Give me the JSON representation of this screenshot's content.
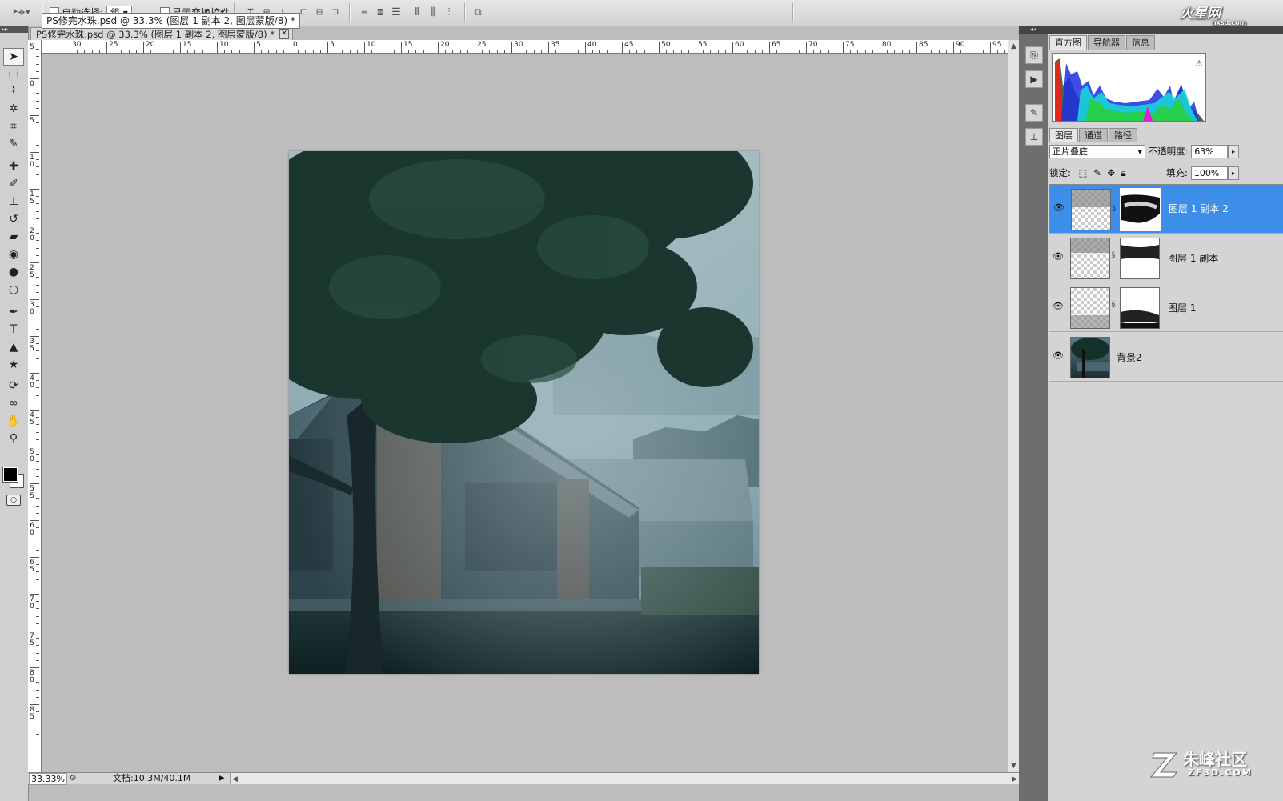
{
  "options_bar": {
    "auto_select_label": "自动选择:",
    "auto_select_value": "组",
    "show_transform_label": "显示变换控件"
  },
  "document": {
    "tooltip": "PS修完水珠.psd @ 33.3% (图层 1 副本 2, 图层蒙版/8) *",
    "tab_title": "PS修完水珠.psd @ 33.3% (图层 1 副本 2, 图层蒙版/8) *",
    "close_glyph": "✕"
  },
  "ruler": {
    "horizontal_labels": [
      "30",
      "25",
      "20",
      "15",
      "10",
      "5",
      "0",
      "5",
      "10",
      "15",
      "20",
      "25",
      "30",
      "35",
      "40",
      "45",
      "50",
      "55",
      "60",
      "65",
      "70",
      "75",
      "80",
      "85",
      "90",
      "95"
    ],
    "vertical_labels": [
      "5",
      "0",
      "5",
      "1\n0",
      "1\n5",
      "2\n0",
      "2\n5",
      "3\n0",
      "3\n5",
      "4\n0",
      "4\n5",
      "5\n0",
      "5\n5",
      "6\n0",
      "6\n5",
      "7\n0",
      "7\n5",
      "8\n0",
      "8\n5"
    ]
  },
  "tools": [
    {
      "name": "move-tool",
      "glyph": "➤"
    },
    {
      "name": "marquee-tool",
      "glyph": "⬚"
    },
    {
      "name": "lasso-tool",
      "glyph": "⌇"
    },
    {
      "name": "quick-select-tool",
      "glyph": "✲"
    },
    {
      "name": "crop-tool",
      "glyph": "⌗"
    },
    {
      "name": "eyedropper-tool",
      "glyph": "✎"
    },
    {
      "name": "healing-brush-tool",
      "glyph": "✚"
    },
    {
      "name": "brush-tool",
      "glyph": "✐"
    },
    {
      "name": "clone-stamp-tool",
      "glyph": "⊥"
    },
    {
      "name": "history-brush-tool",
      "glyph": "↺"
    },
    {
      "name": "eraser-tool",
      "glyph": "▰"
    },
    {
      "name": "paint-bucket-tool",
      "glyph": "◉"
    },
    {
      "name": "blur-tool",
      "glyph": "●"
    },
    {
      "name": "dodge-tool",
      "glyph": "○"
    },
    {
      "name": "pen-tool",
      "glyph": "✒"
    },
    {
      "name": "type-tool",
      "glyph": "T"
    },
    {
      "name": "path-select-tool",
      "glyph": "▲"
    },
    {
      "name": "shape-tool",
      "glyph": "★"
    },
    {
      "name": "3d-rotate-tool",
      "glyph": "⟳"
    },
    {
      "name": "3d-orbit-tool",
      "glyph": "∞"
    },
    {
      "name": "hand-tool",
      "glyph": "✋"
    },
    {
      "name": "zoom-tool",
      "glyph": "⚲"
    }
  ],
  "status": {
    "zoom": "33.33%",
    "doc_info": "文档:10.3M/40.1M"
  },
  "panels": {
    "top_tabs": [
      "直方图",
      "导航器",
      "信息"
    ],
    "histogram_warning": "⚠",
    "layer_tabs": [
      "图层",
      "通道",
      "路径"
    ],
    "blend_mode": "正片叠底",
    "opacity_label": "不透明度:",
    "opacity_value": "63%",
    "lock_label": "锁定:",
    "fill_label": "填充:",
    "fill_value": "100%"
  },
  "layers": [
    {
      "name": "图层 1 副本 2",
      "selected": true
    },
    {
      "name": "图层 1 副本",
      "selected": false
    },
    {
      "name": "图层 1",
      "selected": false
    },
    {
      "name": "背景2",
      "selected": false
    }
  ],
  "watermarks": {
    "top": "火星网",
    "top_small": "hxsd.com",
    "bottom_cn": "朱峰社区",
    "bottom_en": "ZF3D.COM"
  },
  "colors": {
    "selection": "#3d8ee8",
    "workspace": "#bdbdbd"
  }
}
